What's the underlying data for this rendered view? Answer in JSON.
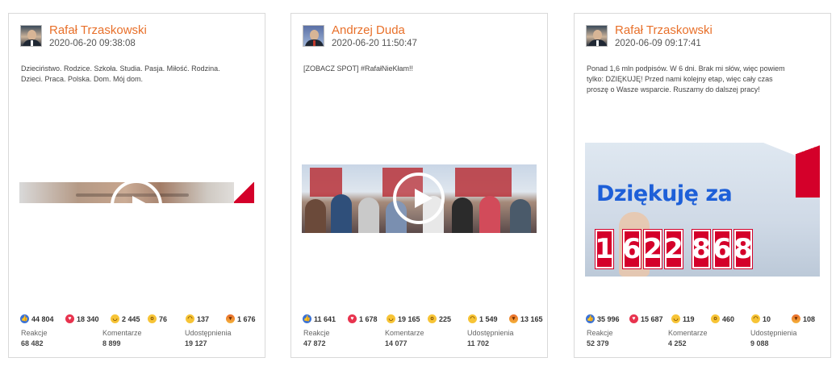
{
  "posts": [
    {
      "author": "Rafał Trzaskowski",
      "date": "2020-06-20 09:38:08",
      "text": "Dzieciństwo. Rodzice. Szkoła. Studia. Pasja. Miłość. Rodzina. Dzieci. Praca. Polska. Dom. Mój dom.",
      "media_type": "video",
      "reactions": {
        "like": "44 804",
        "love": "18 340",
        "haha": "2 445",
        "wow": "76",
        "sad": "137",
        "angry": "1 676"
      },
      "stats_labels": {
        "reactions": "Reakcje",
        "comments": "Komentarze",
        "shares": "Udostępnienia"
      },
      "stats": {
        "reactions": "68 482",
        "comments": "8 899",
        "shares": "19 127"
      }
    },
    {
      "author": "Andrzej Duda",
      "date": "2020-06-20 11:50:47",
      "text": "[ZOBACZ SPOT] #RafałNieKłam!!",
      "media_type": "video",
      "reactions": {
        "like": "11 641",
        "love": "1 678",
        "haha": "19 165",
        "wow": "225",
        "sad": "1 549",
        "angry": "13 165"
      },
      "stats_labels": {
        "reactions": "Reakcje",
        "comments": "Komentarze",
        "shares": "Udostępnienia"
      },
      "stats": {
        "reactions": "47 872",
        "comments": "14 077",
        "shares": "11 702"
      }
    },
    {
      "author": "Rafał Trzaskowski",
      "date": "2020-06-09 09:17:41",
      "text": "Ponad 1,6 mln podpisów. W 6 dni. Brak mi słów, więc powiem tylko: DZIĘKUJĘ! Przed nami kolejny etap, więc cały czas proszę o Wasze wsparcie. Ruszamy do dalszej pracy!",
      "media_type": "image",
      "image_headline": "Dziękuję za",
      "image_digits": [
        "1",
        "6",
        "2",
        "2",
        "8",
        "6",
        "8"
      ],
      "reactions": {
        "like": "35 996",
        "love": "15 687",
        "haha": "119",
        "wow": "460",
        "sad": "10",
        "angry": "108"
      },
      "stats_labels": {
        "reactions": "Reakcje",
        "comments": "Komentarze",
        "shares": "Udostępnienia"
      },
      "stats": {
        "reactions": "52 379",
        "comments": "4 252",
        "shares": "9 088"
      }
    }
  ],
  "colors": {
    "author": "#e8702a",
    "accent_red": "#d4002a",
    "headline_blue": "#1d5fd8"
  }
}
